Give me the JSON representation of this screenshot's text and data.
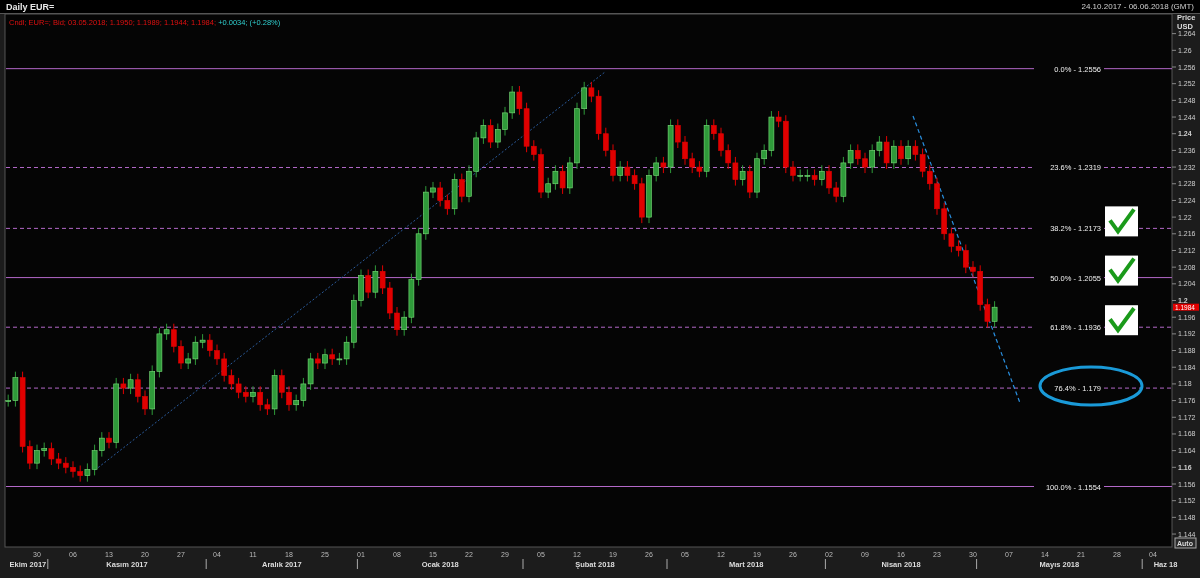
{
  "header": {
    "title": "Daily EUR=",
    "range": "24.10.2017 - 06.06.2018 (GMT)"
  },
  "legend": {
    "quote": "Cndl; EUR=; Bid; 03.05.2018; 1.1950; 1.1989; 1.1944; 1.1984;",
    "change": "+0.0034; (+0.28%)"
  },
  "axis": {
    "title": "Price",
    "unit": "USD",
    "last_price": "1.1984",
    "auto_button": "Auto"
  },
  "price_labels": [
    "1.264",
    "1.26",
    "1.256",
    "1.252",
    "1.248",
    "1.244",
    "1.24",
    "1.236",
    "1.232",
    "1.228",
    "1.224",
    "1.22",
    "1.216",
    "1.212",
    "1.208",
    "1.204",
    "1.2",
    "1.196",
    "1.192",
    "1.188",
    "1.184",
    "1.18",
    "1.176",
    "1.172",
    "1.168",
    "1.164",
    "1.16",
    "1.156",
    "1.152",
    "1.148",
    "1.144"
  ],
  "day_labels": [
    "30",
    "06",
    "13",
    "20",
    "27",
    "04",
    "11",
    "18",
    "25",
    "01",
    "08",
    "15",
    "22",
    "29",
    "05",
    "12",
    "19",
    "26",
    "05",
    "12",
    "19",
    "26",
    "02",
    "09",
    "16",
    "23",
    "30",
    "07",
    "14",
    "21",
    "28",
    "04"
  ],
  "month_labels": [
    "Ekim 2017",
    "Kasım 2017",
    "Aralık 2017",
    "Ocak 2018",
    "Şubat 2018",
    "Mart 2018",
    "Nisan 2018",
    "Mayıs 2018",
    "Haz 18"
  ],
  "fib_levels": [
    {
      "label": "0.0% - 1.2556",
      "kind": "solid",
      "checked": false,
      "circled": false
    },
    {
      "label": "23.6% - 1.2319",
      "kind": "dashed",
      "checked": false,
      "circled": false
    },
    {
      "label": "38.2% - 1.2173",
      "kind": "dashed",
      "checked": true,
      "circled": false
    },
    {
      "label": "50.0% - 1.2055",
      "kind": "solid",
      "checked": true,
      "circled": false
    },
    {
      "label": "61.8% - 1.1936",
      "kind": "dashed",
      "checked": true,
      "circled": false
    },
    {
      "label": "76.4% - 1.179",
      "kind": "dashed",
      "checked": false,
      "circled": true
    },
    {
      "label": "100.0% - 1.1554",
      "kind": "solid",
      "checked": false,
      "circled": false
    }
  ]
}
